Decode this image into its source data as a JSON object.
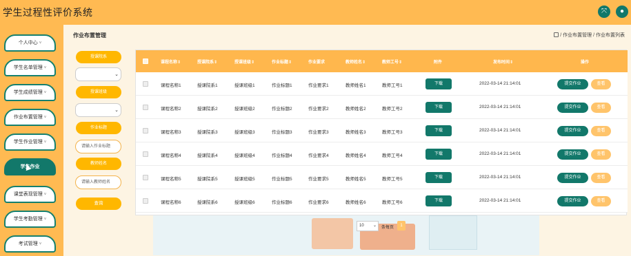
{
  "app": {
    "title": "学生过程性评价系统"
  },
  "header": {
    "icons": [
      {
        "name": "fullscreen-icon",
        "glyph": "⤧"
      },
      {
        "name": "user-icon",
        "glyph": "●"
      }
    ]
  },
  "sidebar": {
    "items": [
      {
        "label": "个人中心",
        "chev": "˅",
        "active": false
      },
      {
        "label": "学生名单管理",
        "chev": "˅",
        "active": false
      },
      {
        "label": "学生成绩管理",
        "chev": "˅",
        "active": false
      },
      {
        "label": "作业布置管理",
        "chev": "˅",
        "active": false
      },
      {
        "label": "学生作业管理",
        "chev": "˅",
        "active": false
      },
      {
        "label": "学生作业",
        "chev": "",
        "active": true
      },
      {
        "label": "课堂表现管理",
        "chev": "˅",
        "active": false
      },
      {
        "label": "学生考勤管理",
        "chev": "˅",
        "active": false
      },
      {
        "label": "考试管理",
        "chev": "˅",
        "active": false
      }
    ]
  },
  "breadcrumb": {
    "page_title": "作业布置管理",
    "trail": "/ 作业布置管理 / 作业布置列表"
  },
  "filters": {
    "class_label": "授课院系",
    "class_select": "",
    "grade_label": "授课班级",
    "grade_select": "",
    "title_label": "作业标题",
    "title_placeholder": "请输入作业标题",
    "teacher_label": "教师姓名",
    "teacher_placeholder": "请输入教师姓名",
    "search_button": "查询"
  },
  "table": {
    "headers": [
      "课程名称⇕",
      "授课院系⇕",
      "授课班级⇕",
      "作业标题⇕",
      "作业要求",
      "教师姓名⇕",
      "教师工号⇕",
      "附件",
      "发布时间⇕",
      "操作"
    ],
    "download_label": "下载",
    "submit_label": "提交作业",
    "view_label": "查看",
    "rows": [
      [
        "课程名称1",
        "授课院系1",
        "授课班级1",
        "作业标题1",
        "作业要求1",
        "教师姓名1",
        "教师工号1",
        "2022-03-14 21:14:01"
      ],
      [
        "课程名称2",
        "授课院系2",
        "授课班级2",
        "作业标题2",
        "作业要求2",
        "教师姓名2",
        "教师工号2",
        "2022-03-14 21:14:01"
      ],
      [
        "课程名称3",
        "授课院系3",
        "授课班级3",
        "作业标题3",
        "作业要求3",
        "教师姓名3",
        "教师工号3",
        "2022-03-14 21:14:01"
      ],
      [
        "课程名称4",
        "授课院系4",
        "授课班级4",
        "作业标题4",
        "作业要求4",
        "教师姓名4",
        "教师工号4",
        "2022-03-14 21:14:01"
      ],
      [
        "课程名称5",
        "授课院系5",
        "授课班级5",
        "作业标题5",
        "作业要求5",
        "教师姓名5",
        "教师工号5",
        "2022-03-14 21:14:01"
      ],
      [
        "课程名称6",
        "授课院系6",
        "授课班级6",
        "作业标题6",
        "作业要求6",
        "教师姓名6",
        "教师工号6",
        "2022-03-14 21:14:01"
      ]
    ]
  },
  "pagination": {
    "page_size": "10",
    "page_size_unit": "条每页",
    "current_page": "1"
  },
  "colors": {
    "primary": "#ffba52",
    "accent": "#12786a",
    "button_orange": "#ffb700"
  }
}
